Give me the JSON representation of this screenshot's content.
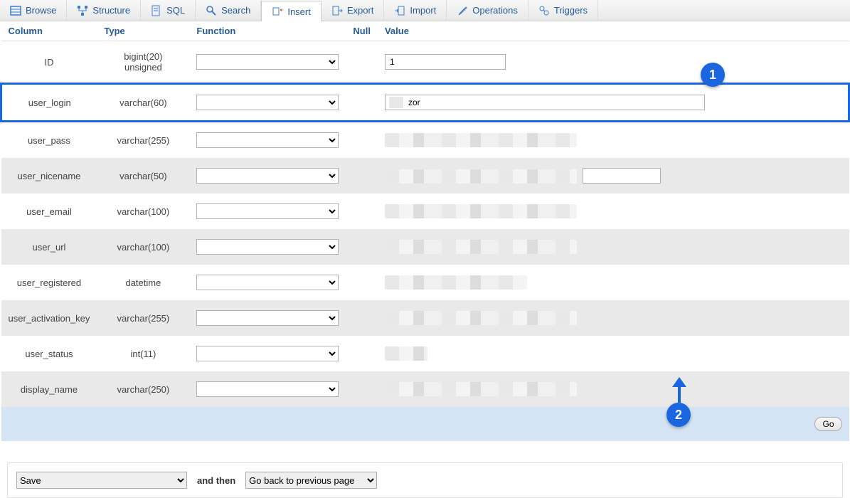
{
  "tabs": [
    {
      "label": "Browse",
      "icon": "browse-icon"
    },
    {
      "label": "Structure",
      "icon": "structure-icon"
    },
    {
      "label": "SQL",
      "icon": "sql-icon"
    },
    {
      "label": "Search",
      "icon": "search-icon"
    },
    {
      "label": "Insert",
      "icon": "insert-icon",
      "active": true
    },
    {
      "label": "Export",
      "icon": "export-icon"
    },
    {
      "label": "Import",
      "icon": "import-icon"
    },
    {
      "label": "Operations",
      "icon": "operations-icon"
    },
    {
      "label": "Triggers",
      "icon": "triggers-icon"
    }
  ],
  "headers": {
    "column": "Column",
    "type": "Type",
    "function": "Function",
    "null": "Null",
    "value": "Value"
  },
  "rows": [
    {
      "column": "ID",
      "type": "bigint(20) unsigned",
      "value": "1",
      "redacted": false,
      "input_width": "value-short"
    },
    {
      "column": "user_login",
      "type": "varchar(60)",
      "value": "zor",
      "redacted": false,
      "input_width": "value-long",
      "highlight": true,
      "partial_redact": true
    },
    {
      "column": "user_pass",
      "type": "varchar(255)",
      "value": "",
      "redacted": true,
      "redact_width": 270
    },
    {
      "column": "user_nicename",
      "type": "varchar(50)",
      "value": "",
      "redacted": true,
      "redact_width": 270,
      "show_input_after": true,
      "input_width": "value-short"
    },
    {
      "column": "user_email",
      "type": "varchar(100)",
      "value": "",
      "redacted": true,
      "redact_width": 270
    },
    {
      "column": "user_url",
      "type": "varchar(100)",
      "value": "",
      "redacted": true,
      "redact_width": 270
    },
    {
      "column": "user_registered",
      "type": "datetime",
      "value": "",
      "redacted": true,
      "redact_width": 200
    },
    {
      "column": "user_activation_key",
      "type": "varchar(255)",
      "value": "",
      "redacted": true,
      "redact_width": 270
    },
    {
      "column": "user_status",
      "type": "int(11)",
      "value": "",
      "redacted": true,
      "redact_width": 60
    },
    {
      "column": "display_name",
      "type": "varchar(250)",
      "value": "",
      "redacted": true,
      "redact_width": 270
    }
  ],
  "go_label": "Go",
  "bottom": {
    "save": "Save",
    "and_then": "and then",
    "then_option": "Go back to previous page"
  },
  "annotations": {
    "badge1": "1",
    "badge2": "2"
  }
}
